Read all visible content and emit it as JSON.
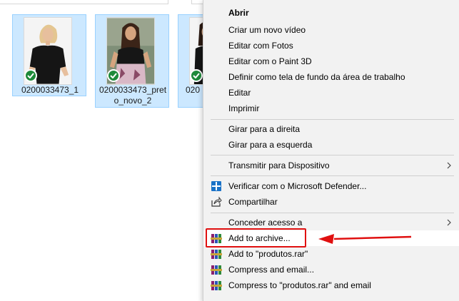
{
  "files": [
    {
      "name": "0200033473_1"
    },
    {
      "name": "0200033473_preto_novo_2",
      "name_display": "0200033473_pret\no_novo_2"
    },
    {
      "name": "020",
      "name_display": "020"
    }
  ],
  "context_menu": {
    "items": [
      {
        "label": "Abrir"
      },
      {
        "label": "Criar um novo vídeo"
      },
      {
        "label": "Editar com Fotos"
      },
      {
        "label": "Editar com o Paint 3D"
      },
      {
        "label": "Definir como tela de fundo da área de trabalho"
      },
      {
        "label": "Editar"
      },
      {
        "label": "Imprimir"
      },
      {
        "label": "Girar para a direita"
      },
      {
        "label": "Girar para a esquerda"
      },
      {
        "label": "Transmitir para Dispositivo"
      },
      {
        "label": "Verificar com o Microsoft Defender..."
      },
      {
        "label": "Compartilhar"
      },
      {
        "label": "Conceder acesso a"
      },
      {
        "label": "Add to archive..."
      },
      {
        "label": "Add to \"produtos.rar\""
      },
      {
        "label": "Compress and email..."
      },
      {
        "label": "Compress to \"produtos.rar\" and email"
      }
    ]
  },
  "colors": {
    "selection_fill": "#cce8ff",
    "selection_border": "#99d1ff",
    "menu_background": "#f2f2f2",
    "annotation_red": "#e01010",
    "sync_green": "#1d8a3a"
  },
  "icons": {
    "sync_status": "green-check-sync-icon",
    "defender": "microsoft-defender-shield-icon",
    "share": "share-icon",
    "winrar": "winrar-books-icon",
    "submenu": "chevron-right-icon"
  }
}
